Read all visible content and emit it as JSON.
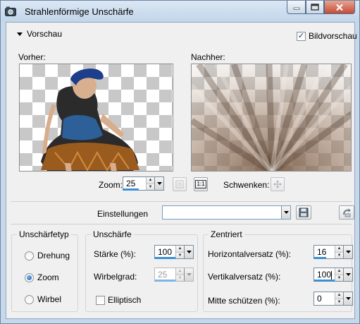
{
  "window": {
    "title": "Strahlenförmige Unschärfe"
  },
  "preview": {
    "toggle_label": "Vorschau",
    "bildvorschau_label": "Bildvorschau",
    "bildvorschau_checked": true,
    "before_label": "Vorher:",
    "after_label": "Nachher:"
  },
  "zoom": {
    "label": "Zoom:",
    "value": "25",
    "pan_label": "Schwenken:",
    "fit_button": "1:1"
  },
  "settings": {
    "label": "Einstellungen",
    "value": ""
  },
  "blur_type": {
    "title": "Unschärfetyp",
    "options": [
      "Drehung",
      "Zoom",
      "Wirbel"
    ],
    "selected": "Zoom"
  },
  "blur": {
    "title": "Unschärfe",
    "strength_label": "Stärke (%):",
    "strength_value": "100",
    "swirl_label": "Wirbelgrad:",
    "swirl_value": "25",
    "elliptic_label": "Elliptisch",
    "elliptic_checked": false
  },
  "center": {
    "title": "Zentriert",
    "h_offset_label": "Horizontalversatz (%):",
    "h_offset_value": "16",
    "v_offset_label": "Vertikalversatz (%):",
    "v_offset_value": "100",
    "protect_label": "Mitte schützen (%):",
    "protect_value": "0"
  }
}
